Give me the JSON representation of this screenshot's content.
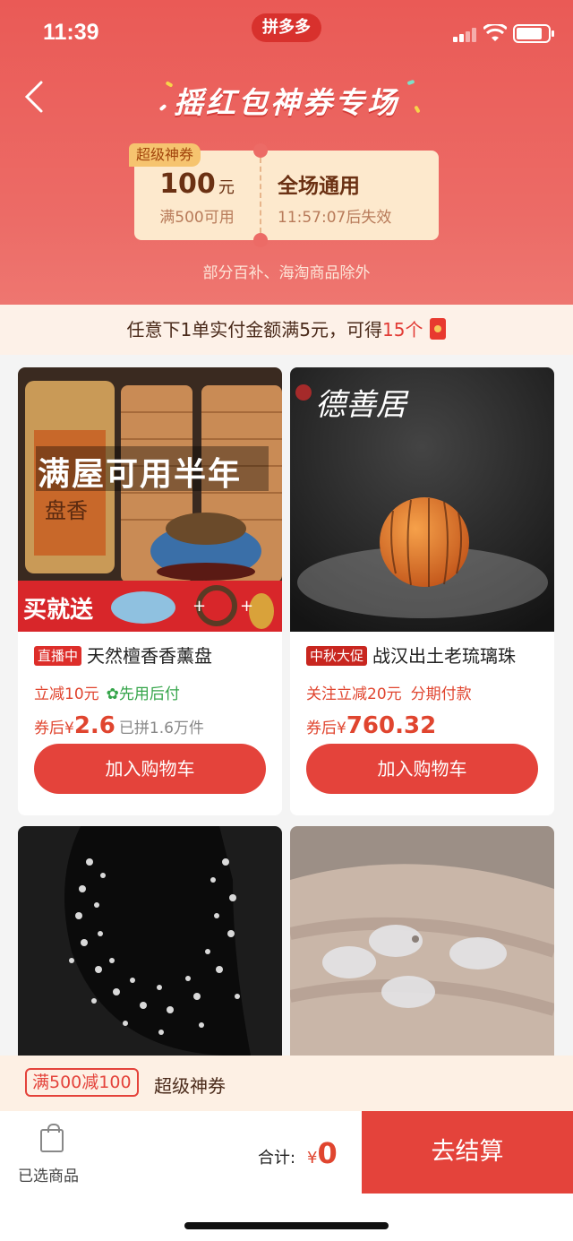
{
  "status_bar": {
    "time": "11:39",
    "app": "拼多多"
  },
  "header": {
    "title": "摇红包神券专场"
  },
  "coupon": {
    "tag": "超级神券",
    "amount": "100",
    "unit": "元",
    "condition": "满500可用",
    "scope": "全场通用",
    "expiry": "11:57:07后失效"
  },
  "exclusion": "部分百补、海淘商品除外",
  "promo": {
    "prefix": "任意下1单实付金额满5元，可得",
    "highlight": "15个"
  },
  "products": [
    {
      "tag": "直播中",
      "title": "天然檀香香薰盘",
      "img_text_1": "满屋可用半年",
      "img_text_2": "买就送",
      "img_label": "盘香",
      "sub1": "立减10元",
      "sub2": "先用后付",
      "price_prefix": "券后",
      "currency": "¥",
      "price": "2.6",
      "sold": "已拼1.6万件",
      "button": "加入购物车"
    },
    {
      "tag": "中秋大促",
      "title": "战汉出土老琉璃珠",
      "img_text_1": "德善居",
      "sub1": "关注立减20元",
      "sub2": "分期付款",
      "price_prefix": "券后",
      "currency": "¥",
      "price": "760.32",
      "button": "加入购物车"
    }
  ],
  "bottom_coupon": {
    "tag": "满500减100",
    "text": "超级神券"
  },
  "bottom_bar": {
    "selected_label": "已选商品",
    "total_label": "合计:",
    "currency": "¥",
    "total": "0",
    "checkout": "去结算"
  },
  "colors": {
    "accent": "#e4433b",
    "header": "#ea5a56",
    "coupon_bg": "#fde9cd"
  }
}
